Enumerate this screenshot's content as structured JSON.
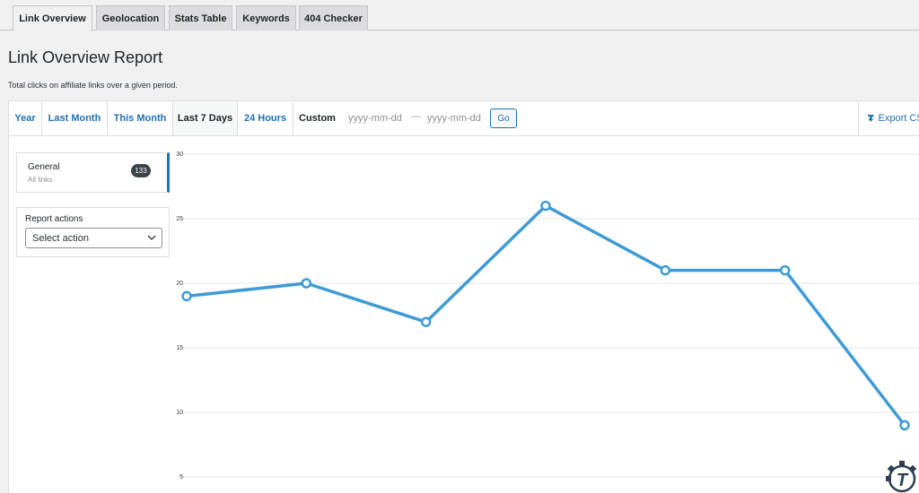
{
  "tabs": [
    "Link Overview",
    "Geolocation",
    "Stats Table",
    "Keywords",
    "404 Checker"
  ],
  "page_title": "Link Overview Report",
  "page_description": "Total clicks on affiliate links over a given period.",
  "periods": {
    "year": "Year",
    "last_month": "Last Month",
    "this_month": "This Month",
    "last_7_days": "Last 7 Days",
    "hours_24": "24 Hours",
    "custom": "Custom"
  },
  "date_start_placeholder": "yyyy-mm-dd",
  "date_separator": "—",
  "date_end_placeholder": "yyyy-mm-dd",
  "go_label": "Go",
  "export_label": "Export CSV",
  "link_group": {
    "title": "General",
    "subtitle": "All links",
    "count": "133"
  },
  "report_actions": {
    "label": "Report actions",
    "selected": "Select action"
  },
  "colors": {
    "accent": "#2271b1",
    "line": "#3e9bd5"
  },
  "icons": {
    "export": "download-icon",
    "select": "chevron-down-icon",
    "watermark": "gear-t-logo-icon"
  },
  "chart_data": {
    "type": "line",
    "x": [
      1,
      2,
      3,
      4,
      5,
      6,
      7
    ],
    "series": [
      {
        "values": [
          19,
          20,
          17,
          26,
          21,
          21,
          9
        ]
      }
    ],
    "yticks": [
      5,
      10,
      15,
      20,
      25,
      30
    ],
    "ylim": [
      5,
      30
    ],
    "grid": true
  }
}
